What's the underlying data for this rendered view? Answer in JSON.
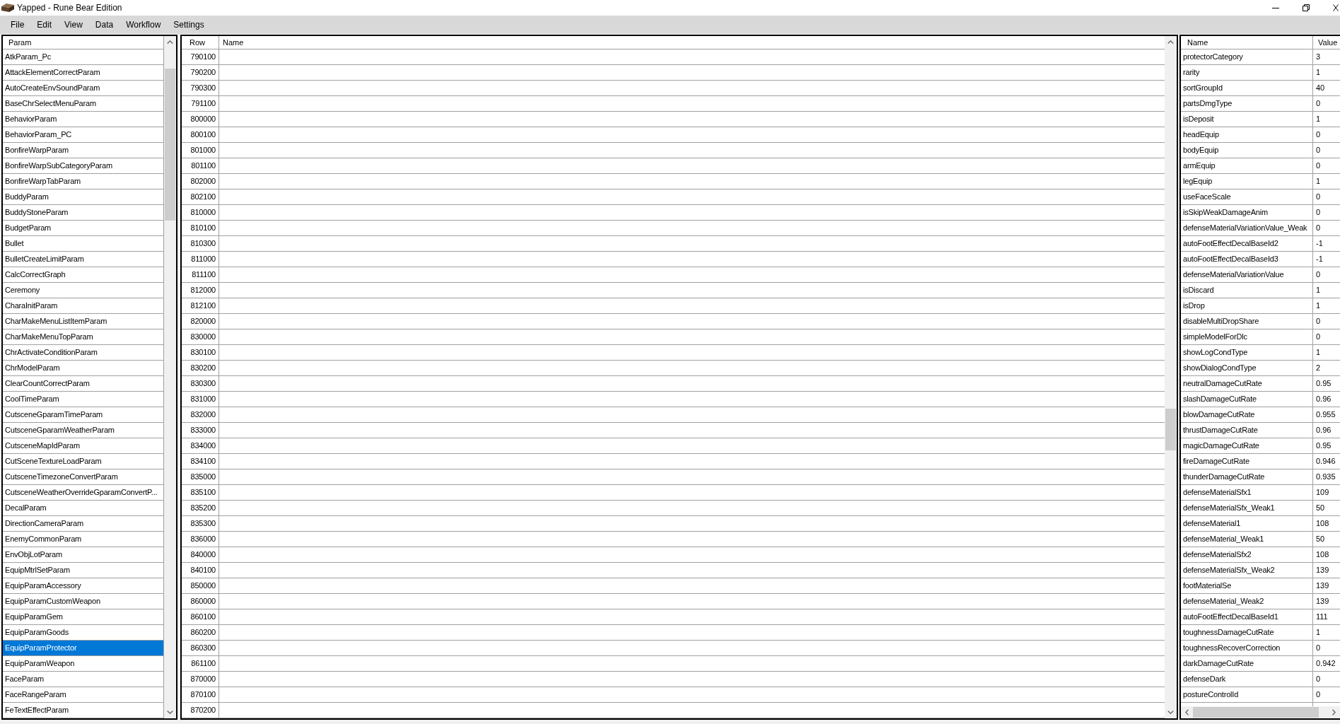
{
  "window": {
    "title": "Yapped - Rune Bear Edition"
  },
  "menu_bar": [
    "File",
    "Edit",
    "View",
    "Data",
    "Workflow",
    "Settings"
  ],
  "param_list": {
    "header": "Param",
    "items": [
      {
        "label": "AtkParam_Pc",
        "selected": false
      },
      {
        "label": "AttackElementCorrectParam",
        "selected": false
      },
      {
        "label": "AutoCreateEnvSoundParam",
        "selected": false
      },
      {
        "label": "BaseChrSelectMenuParam",
        "selected": false
      },
      {
        "label": "BehaviorParam",
        "selected": false
      },
      {
        "label": "BehaviorParam_PC",
        "selected": false
      },
      {
        "label": "BonfireWarpParam",
        "selected": false
      },
      {
        "label": "BonfireWarpSubCategoryParam",
        "selected": false
      },
      {
        "label": "BonfireWarpTabParam",
        "selected": false
      },
      {
        "label": "BuddyParam",
        "selected": false
      },
      {
        "label": "BuddyStoneParam",
        "selected": false
      },
      {
        "label": "BudgetParam",
        "selected": false
      },
      {
        "label": "Bullet",
        "selected": false
      },
      {
        "label": "BulletCreateLimitParam",
        "selected": false
      },
      {
        "label": "CalcCorrectGraph",
        "selected": false
      },
      {
        "label": "Ceremony",
        "selected": false
      },
      {
        "label": "CharaInitParam",
        "selected": false
      },
      {
        "label": "CharMakeMenuListItemParam",
        "selected": false
      },
      {
        "label": "CharMakeMenuTopParam",
        "selected": false
      },
      {
        "label": "ChrActivateConditionParam",
        "selected": false
      },
      {
        "label": "ChrModelParam",
        "selected": false
      },
      {
        "label": "ClearCountCorrectParam",
        "selected": false
      },
      {
        "label": "CoolTimeParam",
        "selected": false
      },
      {
        "label": "CutsceneGparamTimeParam",
        "selected": false
      },
      {
        "label": "CutsceneGparamWeatherParam",
        "selected": false
      },
      {
        "label": "CutsceneMapIdParam",
        "selected": false
      },
      {
        "label": "CutSceneTextureLoadParam",
        "selected": false
      },
      {
        "label": "CutsceneTimezoneConvertParam",
        "selected": false
      },
      {
        "label": "CutsceneWeatherOverrideGparamConvertP...",
        "selected": false
      },
      {
        "label": "DecalParam",
        "selected": false
      },
      {
        "label": "DirectionCameraParam",
        "selected": false
      },
      {
        "label": "EnemyCommonParam",
        "selected": false
      },
      {
        "label": "EnvObjLotParam",
        "selected": false
      },
      {
        "label": "EquipMtrlSetParam",
        "selected": false
      },
      {
        "label": "EquipParamAccessory",
        "selected": false
      },
      {
        "label": "EquipParamCustomWeapon",
        "selected": false
      },
      {
        "label": "EquipParamGem",
        "selected": false
      },
      {
        "label": "EquipParamGoods",
        "selected": false
      },
      {
        "label": "EquipParamProtector",
        "selected": true
      },
      {
        "label": "EquipParamWeapon",
        "selected": false
      },
      {
        "label": "FaceParam",
        "selected": false
      },
      {
        "label": "FaceRangeParam",
        "selected": false
      },
      {
        "label": "FeTextEffectParam",
        "selected": false
      }
    ]
  },
  "rows_table": {
    "columns": [
      "Row",
      "Name"
    ],
    "rows": [
      {
        "row": "790100",
        "selected": false
      },
      {
        "row": "790200",
        "selected": false
      },
      {
        "row": "790300",
        "selected": false
      },
      {
        "row": "791100",
        "selected": false
      },
      {
        "row": "800000",
        "selected": false
      },
      {
        "row": "800100",
        "selected": false
      },
      {
        "row": "801000",
        "selected": false
      },
      {
        "row": "801100",
        "selected": false
      },
      {
        "row": "802000",
        "selected": false
      },
      {
        "row": "802100",
        "selected": false
      },
      {
        "row": "810000",
        "selected": false
      },
      {
        "row": "810100",
        "selected": false
      },
      {
        "row": "810300",
        "selected": false
      },
      {
        "row": "811000",
        "selected": false
      },
      {
        "row": "811100",
        "selected": false
      },
      {
        "row": "812000",
        "selected": false
      },
      {
        "row": "812100",
        "selected": false
      },
      {
        "row": "820000",
        "selected": false
      },
      {
        "row": "830000",
        "selected": false
      },
      {
        "row": "830100",
        "selected": false
      },
      {
        "row": "830200",
        "selected": false
      },
      {
        "row": "830300",
        "selected": false
      },
      {
        "row": "831000",
        "selected": false
      },
      {
        "row": "832000",
        "selected": false
      },
      {
        "row": "833000",
        "selected": false
      },
      {
        "row": "834000",
        "selected": false
      },
      {
        "row": "834100",
        "selected": false
      },
      {
        "row": "835000",
        "selected": false
      },
      {
        "row": "835100",
        "selected": false
      },
      {
        "row": "835200",
        "selected": false
      },
      {
        "row": "835300",
        "selected": false
      },
      {
        "row": "836000",
        "selected": false
      },
      {
        "row": "840000",
        "selected": false
      },
      {
        "row": "840100",
        "selected": false
      },
      {
        "row": "850000",
        "selected": false
      },
      {
        "row": "860000",
        "selected": false
      },
      {
        "row": "860100",
        "selected": false
      },
      {
        "row": "860200",
        "selected": false
      },
      {
        "row": "860300",
        "selected": false
      },
      {
        "row": "861100",
        "selected": false
      },
      {
        "row": "870000",
        "selected": false
      },
      {
        "row": "870100",
        "selected": false
      },
      {
        "row": "870200",
        "selected": false
      }
    ]
  },
  "fields_table": {
    "columns": [
      "Name",
      "Value"
    ],
    "rows": [
      {
        "name": "protectorCategory",
        "value": "3"
      },
      {
        "name": "rarity",
        "value": "1"
      },
      {
        "name": "sortGroupId",
        "value": "40"
      },
      {
        "name": "partsDmgType",
        "value": "0"
      },
      {
        "name": "isDeposit",
        "value": "1"
      },
      {
        "name": "headEquip",
        "value": "0"
      },
      {
        "name": "bodyEquip",
        "value": "0"
      },
      {
        "name": "armEquip",
        "value": "0"
      },
      {
        "name": "legEquip",
        "value": "1"
      },
      {
        "name": "useFaceScale",
        "value": "0"
      },
      {
        "name": "isSkipWeakDamageAnim",
        "value": "0"
      },
      {
        "name": "defenseMaterialVariationValue_Weak",
        "value": "0"
      },
      {
        "name": "autoFootEffectDecalBaseId2",
        "value": "-1"
      },
      {
        "name": "autoFootEffectDecalBaseId3",
        "value": "-1"
      },
      {
        "name": "defenseMaterialVariationValue",
        "value": "0"
      },
      {
        "name": "isDiscard",
        "value": "1"
      },
      {
        "name": "isDrop",
        "value": "1"
      },
      {
        "name": "disableMultiDropShare",
        "value": "0"
      },
      {
        "name": "simpleModelForDlc",
        "value": "0"
      },
      {
        "name": "showLogCondType",
        "value": "1"
      },
      {
        "name": "showDialogCondType",
        "value": "2"
      },
      {
        "name": "neutralDamageCutRate",
        "value": "0.95"
      },
      {
        "name": "slashDamageCutRate",
        "value": "0.96"
      },
      {
        "name": "blowDamageCutRate",
        "value": "0.955"
      },
      {
        "name": "thrustDamageCutRate",
        "value": "0.96"
      },
      {
        "name": "magicDamageCutRate",
        "value": "0.95"
      },
      {
        "name": "fireDamageCutRate",
        "value": "0.946"
      },
      {
        "name": "thunderDamageCutRate",
        "value": "0.935"
      },
      {
        "name": "defenseMaterialSfx1",
        "value": "109"
      },
      {
        "name": "defenseMaterialSfx_Weak1",
        "value": "50"
      },
      {
        "name": "defenseMaterial1",
        "value": "108"
      },
      {
        "name": "defenseMaterial_Weak1",
        "value": "50"
      },
      {
        "name": "defenseMaterialSfx2",
        "value": "108"
      },
      {
        "name": "defenseMaterialSfx_Weak2",
        "value": "139"
      },
      {
        "name": "footMaterialSe",
        "value": "139"
      },
      {
        "name": "defenseMaterial_Weak2",
        "value": "139"
      },
      {
        "name": "autoFootEffectDecalBaseId1",
        "value": "111"
      },
      {
        "name": "toughnessDamageCutRate",
        "value": "1"
      },
      {
        "name": "toughnessRecoverCorrection",
        "value": "0"
      },
      {
        "name": "darkDamageCutRate",
        "value": "0.942"
      },
      {
        "name": "defenseDark",
        "value": "0"
      },
      {
        "name": "postureControlId",
        "value": "0"
      }
    ]
  }
}
